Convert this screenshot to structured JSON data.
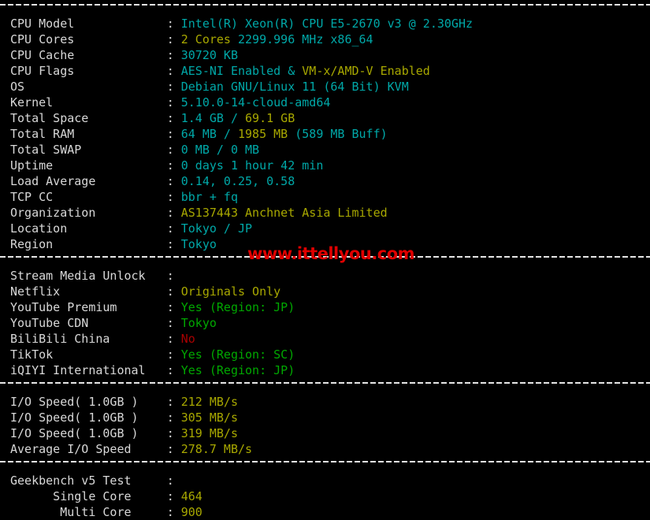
{
  "terminal": {
    "colors": {
      "background": "#000000",
      "label": "#d8d8d8",
      "cyan": "#00a8a8",
      "yellow": "#a8a800",
      "green": "#00a800",
      "red": "#a80000",
      "watermark": "#e00000"
    },
    "watermark": "www.ittellyou.com",
    "separator": "- - - - - - - - - - - - - - - - - - - - - - - - - - - - - - - - - - - - -"
  },
  "system_info": {
    "rows": [
      {
        "label": "CPU Model",
        "colon": ":",
        "segments": [
          {
            "text": "Intel(R) Xeon(R) CPU E5-2670 v3 @ 2.30GHz",
            "color": "cyan"
          }
        ]
      },
      {
        "label": "CPU Cores",
        "colon": ":",
        "segments": [
          {
            "text": "2 Cores",
            "color": "yellow"
          },
          {
            "text": " 2299.996 MHz x86_64",
            "color": "cyan"
          }
        ]
      },
      {
        "label": "CPU Cache",
        "colon": ":",
        "segments": [
          {
            "text": "30720 KB",
            "color": "cyan"
          }
        ]
      },
      {
        "label": "CPU Flags",
        "colon": ":",
        "segments": [
          {
            "text": "AES-NI Enabled",
            "color": "cyan"
          },
          {
            "text": " & ",
            "color": "cyan"
          },
          {
            "text": "VM-x/AMD-V Enabled",
            "color": "yellow"
          }
        ]
      },
      {
        "label": "OS",
        "colon": ":",
        "segments": [
          {
            "text": "Debian GNU/Linux 11 (64 Bit) KVM",
            "color": "cyan"
          }
        ]
      },
      {
        "label": "Kernel",
        "colon": ":",
        "segments": [
          {
            "text": "5.10.0-14-cloud-amd64",
            "color": "cyan"
          }
        ]
      },
      {
        "label": "Total Space",
        "colon": ":",
        "segments": [
          {
            "text": "1.4 GB / ",
            "color": "cyan"
          },
          {
            "text": "69.1 GB",
            "color": "yellow"
          }
        ]
      },
      {
        "label": "Total RAM",
        "colon": ":",
        "segments": [
          {
            "text": "64 MB / ",
            "color": "cyan"
          },
          {
            "text": "1985 MB",
            "color": "yellow"
          },
          {
            "text": " (589 MB Buff)",
            "color": "cyan"
          }
        ]
      },
      {
        "label": "Total SWAP",
        "colon": ":",
        "segments": [
          {
            "text": "0 MB / 0 MB",
            "color": "cyan"
          }
        ]
      },
      {
        "label": "Uptime",
        "colon": ":",
        "segments": [
          {
            "text": "0 days 1 hour 42 min",
            "color": "cyan"
          }
        ]
      },
      {
        "label": "Load Average",
        "colon": ":",
        "segments": [
          {
            "text": "0.14, 0.25, 0.58",
            "color": "cyan"
          }
        ]
      },
      {
        "label": "TCP CC",
        "colon": ":",
        "segments": [
          {
            "text": "bbr + fq",
            "color": "cyan"
          }
        ]
      },
      {
        "label": "Organization",
        "colon": ":",
        "segments": [
          {
            "text": "AS137443 Anchnet Asia Limited",
            "color": "yellow"
          }
        ]
      },
      {
        "label": "Location",
        "colon": ":",
        "segments": [
          {
            "text": "Tokyo / JP",
            "color": "cyan"
          }
        ]
      },
      {
        "label": "Region",
        "colon": ":",
        "segments": [
          {
            "text": "Tokyo",
            "color": "cyan"
          }
        ]
      }
    ]
  },
  "stream_media": {
    "rows": [
      {
        "label": "Stream Media Unlock",
        "colon": ":",
        "segments": []
      },
      {
        "label": "Netflix",
        "colon": ":",
        "segments": [
          {
            "text": "Originals Only",
            "color": "yellow"
          }
        ]
      },
      {
        "label": "YouTube Premium",
        "colon": ":",
        "segments": [
          {
            "text": "Yes (Region: JP)",
            "color": "green"
          }
        ]
      },
      {
        "label": "YouTube CDN",
        "colon": ":",
        "segments": [
          {
            "text": "Tokyo",
            "color": "green"
          }
        ]
      },
      {
        "label": "BiliBili China",
        "colon": ":",
        "segments": [
          {
            "text": "No",
            "color": "red"
          }
        ]
      },
      {
        "label": "TikTok",
        "colon": ":",
        "segments": [
          {
            "text": "Yes (Region: SC)",
            "color": "green"
          }
        ]
      },
      {
        "label": "iQIYI International",
        "colon": ":",
        "segments": [
          {
            "text": "Yes (Region: JP)",
            "color": "green"
          }
        ]
      }
    ]
  },
  "io_speed": {
    "rows": [
      {
        "label": "I/O Speed( 1.0GB )",
        "colon": ":",
        "segments": [
          {
            "text": "212 MB/s",
            "color": "yellow"
          }
        ]
      },
      {
        "label": "I/O Speed( 1.0GB )",
        "colon": ":",
        "segments": [
          {
            "text": "305 MB/s",
            "color": "yellow"
          }
        ]
      },
      {
        "label": "I/O Speed( 1.0GB )",
        "colon": ":",
        "segments": [
          {
            "text": "319 MB/s",
            "color": "yellow"
          }
        ]
      },
      {
        "label": "Average I/O Speed",
        "colon": ":",
        "segments": [
          {
            "text": "278.7 MB/s",
            "color": "yellow"
          }
        ]
      }
    ]
  },
  "geekbench": {
    "rows": [
      {
        "label": "Geekbench v5 Test",
        "colon": ":",
        "segments": []
      },
      {
        "label": "      Single Core",
        "colon": ":",
        "segments": [
          {
            "text": "464",
            "color": "yellow"
          }
        ]
      },
      {
        "label": "       Multi Core",
        "colon": ":",
        "segments": [
          {
            "text": "900",
            "color": "yellow"
          }
        ]
      }
    ]
  }
}
